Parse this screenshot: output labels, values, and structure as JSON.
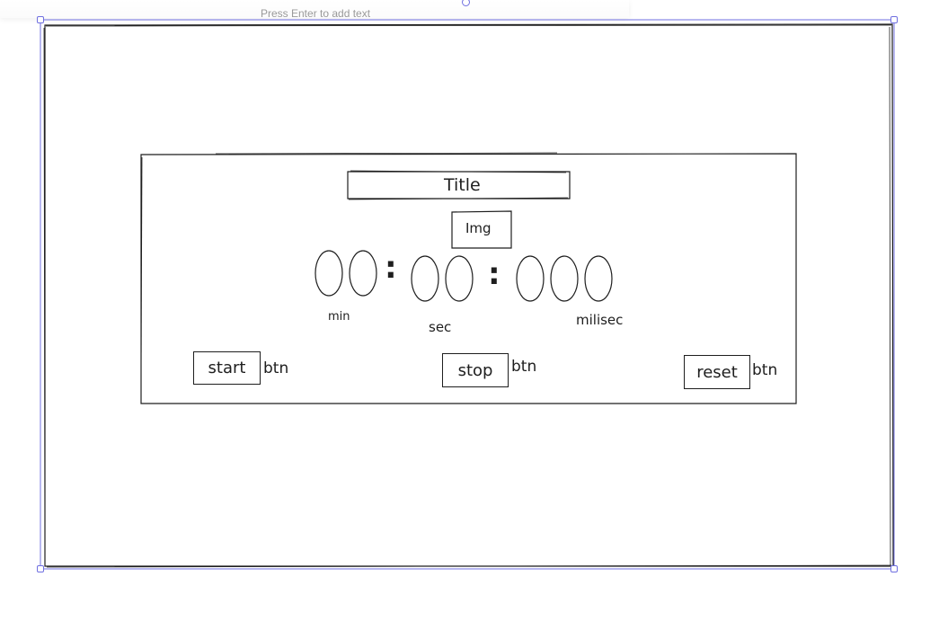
{
  "toolbar_hint": {
    "text": "Press Enter to add text"
  },
  "wireframe": {
    "title_label": "Title",
    "image_label": "Img",
    "timer": {
      "colon_1": ":",
      "colon_2": ":",
      "min_label": "min",
      "sec_label": "sec",
      "milisec_label": "milisec"
    },
    "buttons": [
      {
        "label": "start",
        "suffix": "btn"
      },
      {
        "label": "stop",
        "suffix": "btn"
      },
      {
        "label": "reset",
        "suffix": "btn"
      }
    ]
  },
  "colors": {
    "stroke": "#1e1e1e",
    "selection": "#6f6fe0",
    "hint_text": "#9a9a9a"
  }
}
